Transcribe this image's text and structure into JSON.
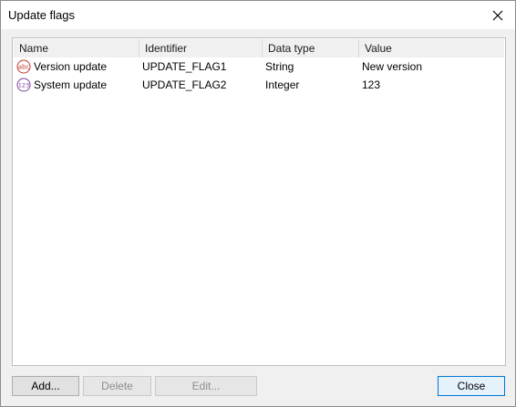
{
  "window": {
    "title": "Update flags"
  },
  "table": {
    "columns": [
      "Name",
      "Identifier",
      "Data type",
      "Value"
    ],
    "rows": [
      {
        "icon": "string-type-icon",
        "icon_text": "abc",
        "name": "Version update",
        "identifier": "UPDATE_FLAG1",
        "data_type": "String",
        "value": "New version"
      },
      {
        "icon": "integer-type-icon",
        "icon_text": "123",
        "name": "System update",
        "identifier": "UPDATE_FLAG2",
        "data_type": "Integer",
        "value": "123"
      }
    ]
  },
  "buttons": {
    "add": "Add...",
    "delete": "Delete",
    "edit": "Edit...",
    "close": "Close"
  },
  "colors": {
    "string_icon": "#c0392b",
    "integer_icon": "#7b3fa0",
    "default_button_border": "#0078d7"
  }
}
